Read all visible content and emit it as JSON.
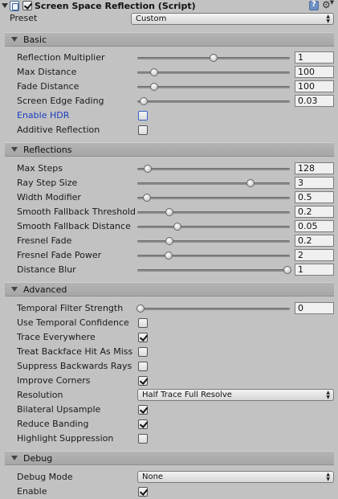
{
  "component": {
    "title": "Screen Space Reflection (Script)",
    "enabled": true,
    "icons": {
      "script": "script-icon",
      "help": "help-icon",
      "settings": "gear-icon"
    }
  },
  "preset": {
    "label": "Preset",
    "value": "Custom"
  },
  "sections": {
    "basic": {
      "title": "Basic",
      "reflection_multiplier": {
        "label": "Reflection Multiplier",
        "value": "1",
        "min": 0,
        "max": 2
      },
      "max_distance": {
        "label": "Max Distance",
        "value": "100",
        "min": 0,
        "max": 1000
      },
      "fade_distance": {
        "label": "Fade Distance",
        "value": "100",
        "min": 0,
        "max": 1000
      },
      "screen_edge_fading": {
        "label": "Screen Edge Fading",
        "value": "0.03",
        "min": 0,
        "max": 1
      },
      "enable_hdr": {
        "label": "Enable HDR",
        "checked": false
      },
      "additive_reflection": {
        "label": "Additive Reflection",
        "checked": false
      }
    },
    "reflections": {
      "title": "Reflections",
      "max_steps": {
        "label": "Max Steps",
        "value": "128",
        "min": 16,
        "max": 2048
      },
      "ray_step_size": {
        "label": "Ray Step Size",
        "value": "3",
        "min": 0,
        "max": 4
      },
      "width_modifier": {
        "label": "Width Modifier",
        "value": "0.5",
        "min": 0,
        "max": 10
      },
      "smooth_fallback_threshold": {
        "label": "Smooth Fallback Threshold",
        "value": "0.2",
        "min": 0,
        "max": 1
      },
      "smooth_fallback_distance": {
        "label": "Smooth Fallback Distance",
        "value": "0.05",
        "min": 0,
        "max": 0.2
      },
      "fresnel_fade": {
        "label": "Fresnel Fade",
        "value": "0.2",
        "min": 0,
        "max": 1
      },
      "fresnel_fade_power": {
        "label": "Fresnel Fade Power",
        "value": "2",
        "min": 0,
        "max": 10
      },
      "distance_blur": {
        "label": "Distance Blur",
        "value": "1",
        "min": 0,
        "max": 1
      }
    },
    "advanced": {
      "title": "Advanced",
      "temporal_filter_strength": {
        "label": "Temporal Filter Strength",
        "value": "0",
        "min": 0,
        "max": 0.99
      },
      "use_temporal_confidence": {
        "label": "Use Temporal Confidence",
        "checked": false
      },
      "trace_everywhere": {
        "label": "Trace Everywhere",
        "checked": true
      },
      "treat_backface_hit_as_miss": {
        "label": "Treat Backface Hit As Miss",
        "checked": false
      },
      "suppress_backwards_rays": {
        "label": "Suppress Backwards Rays",
        "checked": false
      },
      "improve_corners": {
        "label": "Improve Corners",
        "checked": true
      },
      "resolution": {
        "label": "Resolution",
        "value": "Half Trace Full Resolve"
      },
      "bilateral_upsample": {
        "label": "Bilateral Upsample",
        "checked": true
      },
      "reduce_banding": {
        "label": "Reduce Banding",
        "checked": true
      },
      "highlight_suppression": {
        "label": "Highlight Suppression",
        "checked": false
      }
    },
    "debug": {
      "title": "Debug",
      "debug_mode": {
        "label": "Debug Mode",
        "value": "None"
      },
      "enable": {
        "label": "Enable",
        "checked": true
      }
    }
  }
}
